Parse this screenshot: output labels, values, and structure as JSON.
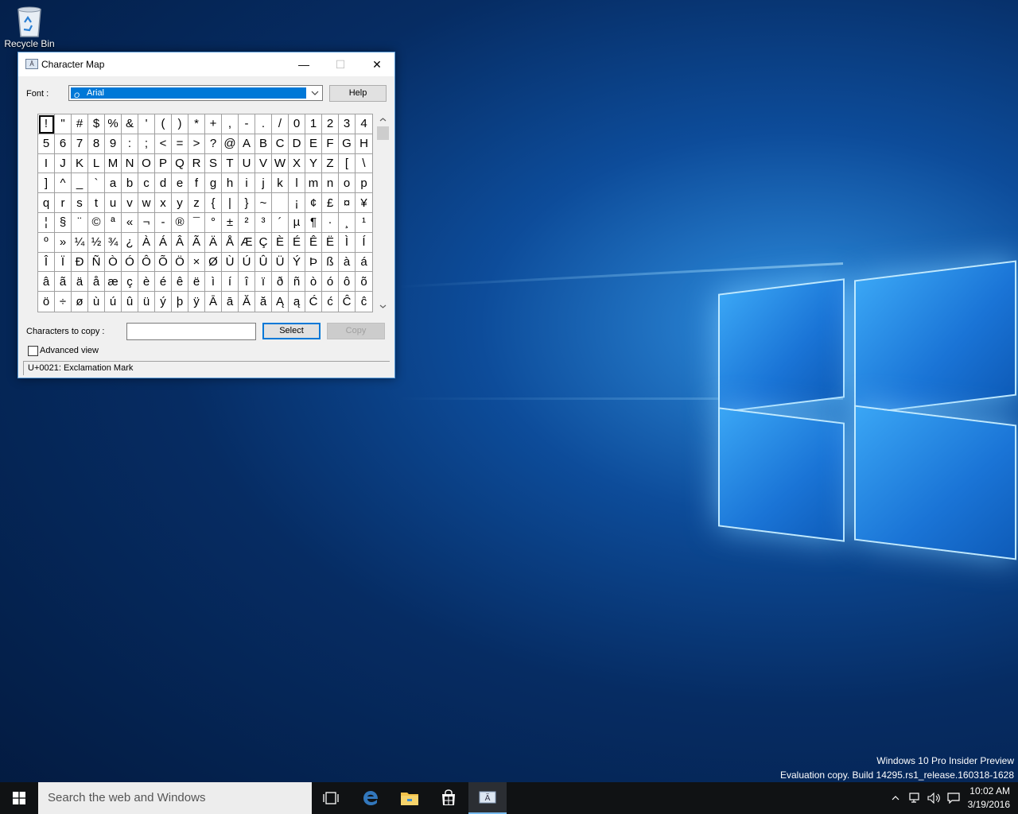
{
  "desktop": {
    "recycle_bin_label": "Recycle Bin",
    "watermark_line1": "Windows 10 Pro Insider Preview",
    "watermark_line2": "Evaluation copy. Build 14295.rs1_release.160318-1628"
  },
  "window": {
    "title": "Character Map",
    "minimize_glyph": "—",
    "maximize_glyph": "☐",
    "close_glyph": "✕"
  },
  "font": {
    "label": "Font :",
    "selected": "Arial",
    "help_label": "Help"
  },
  "grid": {
    "selected_index": 0,
    "characters": [
      "!",
      "\"",
      "#",
      "$",
      "%",
      "&",
      "'",
      "(",
      ")",
      "*",
      "+",
      ",",
      "-",
      ".",
      "/",
      "0",
      "1",
      "2",
      "3",
      "4",
      "5",
      "6",
      "7",
      "8",
      "9",
      ":",
      ";",
      "<",
      "=",
      ">",
      "?",
      "@",
      "A",
      "B",
      "C",
      "D",
      "E",
      "F",
      "G",
      "H",
      "I",
      "J",
      "K",
      "L",
      "M",
      "N",
      "O",
      "P",
      "Q",
      "R",
      "S",
      "T",
      "U",
      "V",
      "W",
      "X",
      "Y",
      "Z",
      "[",
      "\\",
      "]",
      "^",
      "_",
      "`",
      "a",
      "b",
      "c",
      "d",
      "e",
      "f",
      "g",
      "h",
      "i",
      "j",
      "k",
      "l",
      "m",
      "n",
      "o",
      "p",
      "q",
      "r",
      "s",
      "t",
      "u",
      "v",
      "w",
      "x",
      "y",
      "z",
      "{",
      "|",
      "}",
      "~",
      " ",
      "¡",
      "¢",
      "£",
      "¤",
      "¥",
      "¦",
      "§",
      "¨",
      "©",
      "ª",
      "«",
      "¬",
      "-",
      "®",
      "¯",
      "°",
      "±",
      "²",
      "³",
      "´",
      "µ",
      "¶",
      "·",
      "¸",
      "¹",
      "º",
      "»",
      "¼",
      "½",
      "¾",
      "¿",
      "À",
      "Á",
      "Â",
      "Ã",
      "Ä",
      "Å",
      "Æ",
      "Ç",
      "È",
      "É",
      "Ê",
      "Ë",
      "Ì",
      "Í",
      "Î",
      "Ï",
      "Ð",
      "Ñ",
      "Ò",
      "Ó",
      "Ô",
      "Õ",
      "Ö",
      "×",
      "Ø",
      "Ù",
      "Ú",
      "Û",
      "Ü",
      "Ý",
      "Þ",
      "ß",
      "à",
      "á",
      "â",
      "ã",
      "ä",
      "å",
      "æ",
      "ç",
      "è",
      "é",
      "ê",
      "ë",
      "ì",
      "í",
      "î",
      "ï",
      "ð",
      "ñ",
      "ò",
      "ó",
      "ô",
      "õ",
      "ö",
      "÷",
      "ø",
      "ù",
      "ú",
      "û",
      "ü",
      "ý",
      "þ",
      "ÿ",
      "Ā",
      "ā",
      "Ă",
      "ă",
      "Ą",
      "ą",
      "Ć",
      "ć",
      "Ĉ",
      "ĉ"
    ]
  },
  "copy": {
    "label": "Characters to copy :",
    "value": "",
    "select_label": "Select",
    "copy_label": "Copy"
  },
  "advanced_view": {
    "label": "Advanced view",
    "checked": false
  },
  "status": "U+0021: Exclamation Mark",
  "taskbar": {
    "search_placeholder": "Search the web and Windows",
    "time": "10:02 AM",
    "date": "3/19/2016"
  },
  "colors": {
    "accent": "#0078d7",
    "taskbar": "#101214"
  }
}
